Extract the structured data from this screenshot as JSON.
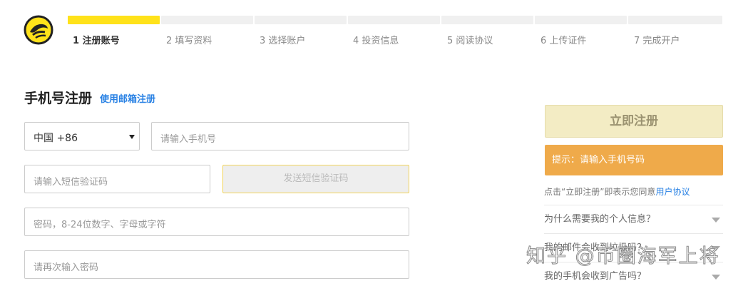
{
  "colors": {
    "accent_yellow": "#ffe21a",
    "link_blue": "#2a82e4",
    "hint_orange": "#efaa4a",
    "register_bg": "#f3ecc4"
  },
  "logo": {
    "icon": "coin-logo-icon"
  },
  "progress": {
    "current_step": 1,
    "steps": [
      {
        "label": "1 注册账号"
      },
      {
        "label": "2 填写资料"
      },
      {
        "label": "3 选择账户"
      },
      {
        "label": "4 投资信息"
      },
      {
        "label": "5 阅读协议"
      },
      {
        "label": "6 上传证件"
      },
      {
        "label": "7 完成开户"
      }
    ]
  },
  "form": {
    "title": "手机号注册",
    "switch_link": "使用邮箱注册",
    "country_code": "中国 +86",
    "phone_placeholder": "请输入手机号",
    "sms_placeholder": "请输入短信验证码",
    "send_code_label": "发送短信验证码",
    "password_placeholder": "密码，8-24位数字、字母或字符",
    "password_confirm_placeholder": "请再次输入密码"
  },
  "side": {
    "register_label": "立即注册",
    "hint_text": "提示：请输入手机号码",
    "agree_prefix": "点击“立即注册”即表示您同意",
    "agree_link": "用户协议",
    "faq": [
      {
        "q": "为什么需要我的个人信息？"
      },
      {
        "q": "我的邮件会收到垃圾吗？"
      },
      {
        "q": "我的手机会收到广告吗？"
      }
    ]
  },
  "watermark": "知乎 @币圈海军上将"
}
